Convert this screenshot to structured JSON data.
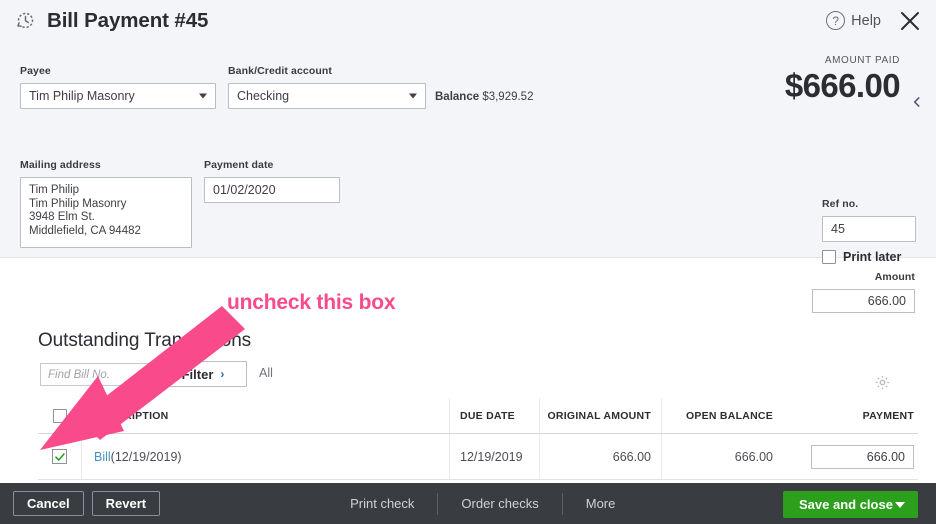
{
  "header": {
    "title": "Bill Payment #45",
    "icon": "history-clock-icon",
    "help_label": "Help",
    "help_mark": "?",
    "close_icon": "close-icon"
  },
  "form": {
    "payee": {
      "label": "Payee",
      "value": "Tim Philip Masonry"
    },
    "bank_account": {
      "label": "Bank/Credit account",
      "value": "Checking"
    },
    "balance": {
      "label": "Balance",
      "value": "$3,929.52"
    },
    "amount_paid": {
      "label": "AMOUNT PAID",
      "value": "$666.00"
    },
    "mailing_address": {
      "label": "Mailing address",
      "line1": "Tim Philip",
      "line2": "Tim Philip Masonry",
      "line3": "3948 Elm St.",
      "line4": "Middlefield, CA  94482"
    },
    "payment_date": {
      "label": "Payment date",
      "value": "01/02/2020"
    },
    "ref_no": {
      "label": "Ref no.",
      "value": "45"
    },
    "print_later": {
      "label": "Print later",
      "checked": false
    }
  },
  "amount_column": {
    "label": "Amount",
    "value": "666.00"
  },
  "outstanding": {
    "title": "Outstanding Transactions",
    "find_placeholder": "Find Bill No.",
    "find_value": "",
    "filter_label": "Filter",
    "filter_chevron": "›",
    "all_label": "All",
    "settings_icon": "gear-icon"
  },
  "table": {
    "columns": [
      "DESCRIPTION",
      "DUE DATE",
      "ORIGINAL AMOUNT",
      "OPEN BALANCE",
      "PAYMENT"
    ],
    "header_checkbox_checked": false,
    "rows": [
      {
        "checked": true,
        "desc_link": "Bill",
        "desc_rest": " (12/19/2019)",
        "due_date": "12/19/2019",
        "original_amount": "666.00",
        "open_balance": "666.00",
        "payment": "666.00"
      }
    ]
  },
  "bottom_bar": {
    "cancel": "Cancel",
    "revert": "Revert",
    "print_check": "Print check",
    "order_checks": "Order checks",
    "more": "More",
    "save_and_close": "Save and close"
  },
  "annotation": {
    "text": "uncheck this box",
    "color": "#f4traded"
  },
  "colors": {
    "annotation_pink": "#f94a8b",
    "save_green": "#2ca01c",
    "bottom_bar": "#393c41",
    "panel_bg": "#f4f5f8",
    "link_blue": "#4a90c4",
    "check_green": "#2ca01c"
  }
}
